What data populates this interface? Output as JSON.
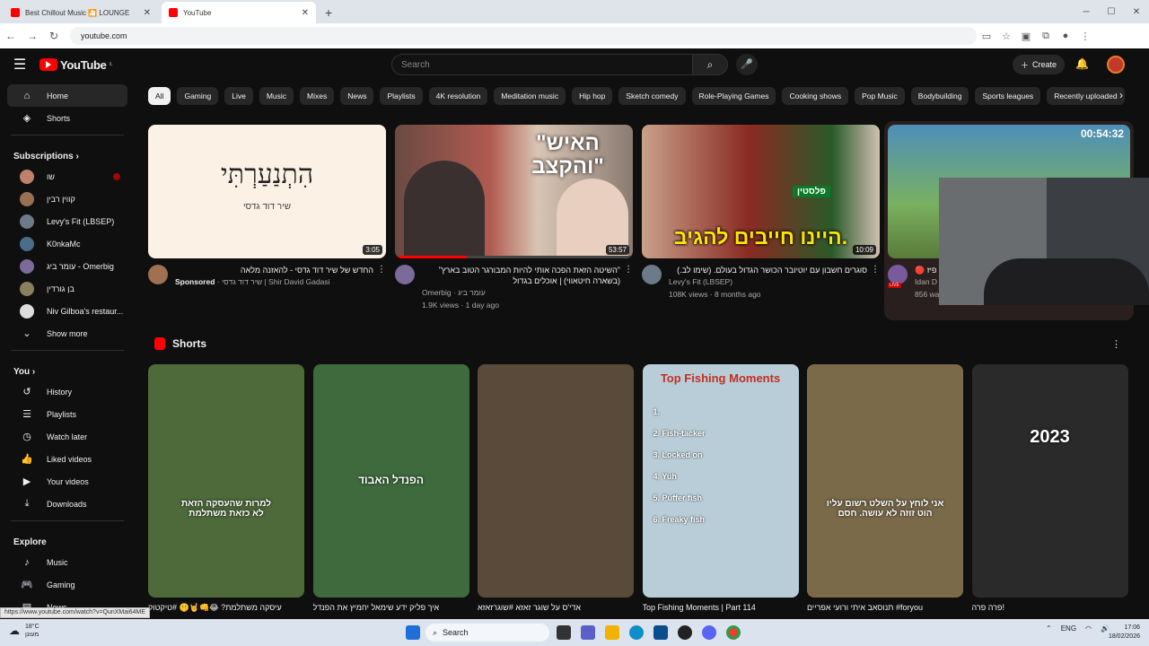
{
  "browser": {
    "tabs": [
      {
        "title": "Best Chillout Music 🎦 LOUNGE",
        "active": false
      },
      {
        "title": "YouTube",
        "active": true
      }
    ],
    "url": "youtube.com",
    "status_url": "https://www.youtube.com/watch?v=QunXMai64ME"
  },
  "header": {
    "logo_text": "YouTube",
    "logo_region": "IL",
    "search_placeholder": "Search",
    "create_label": "Create"
  },
  "sidebar": {
    "main": [
      {
        "label": "Home",
        "icon": "home-icon",
        "active": true
      },
      {
        "label": "Shorts",
        "icon": "shorts-icon",
        "active": false
      }
    ],
    "subscriptions_title": "Subscriptions",
    "subscriptions": [
      {
        "label": "שו",
        "color": "#c0806a",
        "live": true
      },
      {
        "label": "קווין רבין",
        "color": "#9a7055",
        "live": false
      },
      {
        "label": "Levy's Fit (LBSEP)",
        "color": "#6c7a89",
        "live": false
      },
      {
        "label": "K0nkaMc",
        "color": "#4a6d8c",
        "live": false
      },
      {
        "label": "עומר ביג - Omerbig",
        "color": "#7b6a9a",
        "live": false
      },
      {
        "label": "בן גורדין",
        "color": "#8a8060",
        "live": false
      },
      {
        "label": "Niv Gilboa's restaur...",
        "color": "#dddddd",
        "live": false
      }
    ],
    "show_more": "Show more",
    "you_title": "You",
    "you": [
      {
        "label": "History",
        "icon": "history-icon"
      },
      {
        "label": "Playlists",
        "icon": "playlists-icon"
      },
      {
        "label": "Watch later",
        "icon": "watch-later-icon"
      },
      {
        "label": "Liked videos",
        "icon": "like-icon"
      },
      {
        "label": "Your videos",
        "icon": "your-videos-icon"
      },
      {
        "label": "Downloads",
        "icon": "download-icon"
      }
    ],
    "explore_title": "Explore",
    "explore": [
      {
        "label": "Music",
        "icon": "music-icon"
      },
      {
        "label": "Gaming",
        "icon": "gaming-icon"
      },
      {
        "label": "News",
        "icon": "news-icon"
      }
    ]
  },
  "chips": [
    "All",
    "Gaming",
    "Live",
    "Music",
    "Mixes",
    "News",
    "Playlists",
    "4K resolution",
    "Meditation music",
    "Hip hop",
    "Sketch comedy",
    "Role-Playing Games",
    "Cooking shows",
    "Pop Music",
    "Bodybuilding",
    "Sports leagues",
    "Recently uploaded"
  ],
  "videos": [
    {
      "title": "החדש של שיר דוד גדסי - להאזנה מלאה",
      "line2": "Sponsored",
      "line2b": " · שיר דוד גדסי | Shir David Gadasi",
      "line3": "",
      "duration": "3:05",
      "thumb_text": "הִתְנַעַרְתִּי",
      "thumb_sub": "שיר דוד גדסי",
      "thumb_bg": "#fbf1e4",
      "avatar": "#a07050"
    },
    {
      "title": "\"השיטה הזאת הפכה אותי להיות המבורגר הטוב בארץ\"",
      "title2": "(בשארה חיטאווי) | אוכלים בגדול",
      "line2": "Omerbig · עומר ביג",
      "line3": "1.9K views · 1 day ago",
      "duration": "53:57",
      "thumb_text": "\"האיש והקצב\"",
      "thumb_bg": "#6a5248",
      "avatar": "#7b6a9a"
    },
    {
      "title": "סוגרים חשבון עם יוטיובר הכושר הגדול בעולם. (שימו לב.)",
      "line2": "Levy's Fit (LBSEP)",
      "line3": "108K views · 8 months ago",
      "duration": "10:09",
      "thumb_text": "היינו חייבים להגיב.",
      "thumb_tag": "פלסטין",
      "thumb_bg": "#8a3a2c",
      "avatar": "#6c7a89"
    },
    {
      "title": "🔴 פיז",
      "line2": "Idan D",
      "line3": "856 watching",
      "duration": "00:54:32",
      "thumb_text": "",
      "thumb_bg": "#4d8fb8",
      "avatar": "#7a5a9a",
      "live": "LIVE"
    }
  ],
  "shorts_title": "Shorts",
  "shorts": [
    {
      "title": "עיסקה משתלמת? 😂👊🤘🤫 #טיקטוק",
      "overlay": "למרות שהעסקה הזאת\nלא כזאת משתלמת",
      "bg": "#4e6a3a"
    },
    {
      "title": "איך פליק ידע שימאל יחמיץ את הפנדל",
      "overlay": "הפנדל האבוד",
      "bg": "#3e6a3e"
    },
    {
      "title": "אדי'ס על שוגר זאזא #שוגרזאזא",
      "overlay": "",
      "bg": "#5a4a3a"
    },
    {
      "title": "Top Fishing Moments | Part 114",
      "overlay": "Top Fishing Moments",
      "list": [
        "1.",
        "2. Fish-tacker",
        "3. Locked on",
        "4. Yuh",
        "5. Puffer fish",
        "6. Freaky fish"
      ],
      "bg": "#b9cdd8"
    },
    {
      "title": "תנוסאב איתי ורועי אפריים #foryou",
      "overlay": "אני לוחץ על השלט רשום עליו\nהוט זוזה לא עושה. חסם",
      "bg": "#7a6a4a"
    },
    {
      "title": "פרה פרה!",
      "overlay": "2023",
      "bg": "#2a2a2a"
    }
  ],
  "taskbar": {
    "weather_temp": "18°C",
    "weather_desc": "מעונן",
    "search_label": "Search",
    "lang": "ENG",
    "time": "17:06",
    "date": "18/02/2026"
  }
}
